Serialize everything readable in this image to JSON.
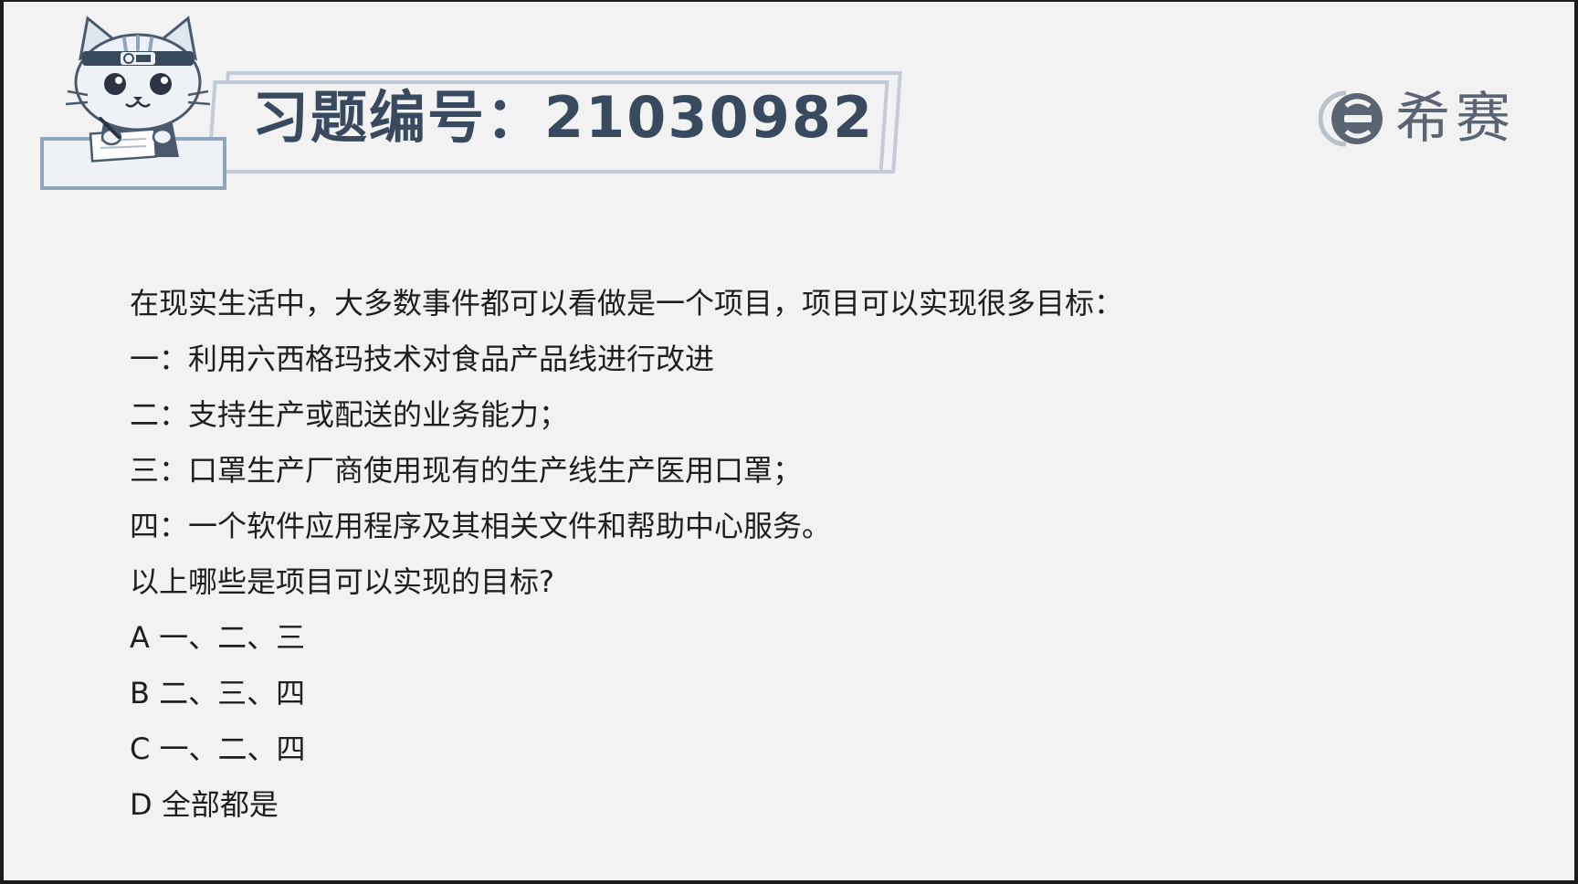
{
  "header": {
    "title_label": "习题编号：",
    "exercise_number": "21030982",
    "brand_name": "希赛"
  },
  "question": {
    "intro": "在现实生活中，大多数事件都可以看做是一个项目，项目可以实现很多目标：",
    "items": [
      "一：利用六西格玛技术对食品产品线进行改进",
      "二：支持生产或配送的业务能力；",
      "三：口罩生产厂商使用现有的生产线生产医用口罩；",
      "四：一个软件应用程序及其相关文件和帮助中心服务。"
    ],
    "prompt": "以上哪些是项目可以实现的目标?"
  },
  "options": [
    {
      "letter": "A",
      "text": "一、二、三"
    },
    {
      "letter": "B",
      "text": "二、三、四"
    },
    {
      "letter": "C",
      "text": "一、二、四"
    },
    {
      "letter": "D",
      "text": "全部都是"
    }
  ],
  "colors": {
    "background": "#f2f2f2",
    "banner_border": "#c3ccd6",
    "title_text": "#3a4a5e",
    "logo": "#5a6472"
  },
  "icons": {
    "mascot": "cat-mascot-icon",
    "logo": "xisai-logo-icon"
  }
}
